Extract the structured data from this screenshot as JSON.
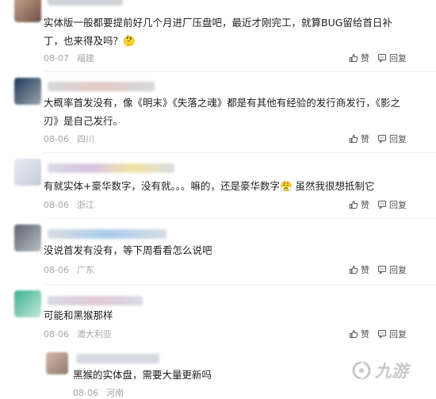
{
  "comments": [
    {
      "text": "实体版一般都要提前好几个月进厂压盘吧，最近才刚完工，就算BUG留给首日补丁，也来得及吗？",
      "emoji": "🤔",
      "date": "08-07",
      "location": "福建",
      "like_label": "赞",
      "reply_label": "回复"
    },
    {
      "text": "大概率首发没有，像《明末》《失落之魂》都是有其他有经验的发行商发行，《影之刃》是自己发行。",
      "date": "08-06",
      "location": "四川",
      "like_label": "赞",
      "reply_label": "回复"
    },
    {
      "text_a": "有就实体+豪华数字，没有就。。。嘛的，还是豪华数字",
      "emoji": "😤",
      "text_b": "虽然我很想抵制它",
      "date": "08-06",
      "location": "浙江",
      "like_label": "赞",
      "reply_label": "回复"
    },
    {
      "text": "没说首发有没有，等下周看看怎么说吧",
      "date": "08-06",
      "location": "广东",
      "like_label": "赞",
      "reply_label": "回复"
    },
    {
      "text": "可能和黑猴那样",
      "date": "08-06",
      "location": "澳大利亚",
      "like_label": "赞",
      "reply_label": "回复"
    }
  ],
  "reply": {
    "text": "黑猴的实体盘，需要大量更新吗",
    "date": "08-06",
    "location": "河南"
  },
  "watermark": {
    "text": "九游",
    "color": "#c8c8c8"
  },
  "colors": {
    "text": "#1f1f1f",
    "meta": "#a6a6a6",
    "action": "#555555"
  },
  "icons": {
    "like": "thumbs-up-icon",
    "reply": "comment-bubble-icon"
  }
}
